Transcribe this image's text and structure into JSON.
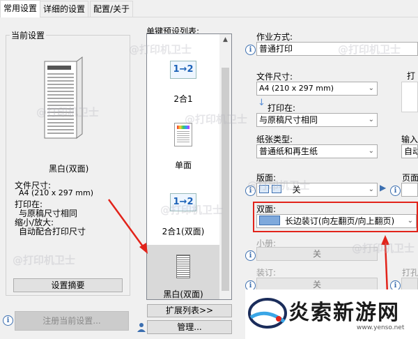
{
  "tabs": [
    "常用设置",
    "详细的设置",
    "配置/关于"
  ],
  "current": {
    "group_label": "当前设置",
    "preview_caption": "黑白(双面)",
    "paper_size_label": "文件尺寸:",
    "paper_size_value": "A4 (210 x 297 mm)",
    "print_on_label": "打印在:",
    "print_on_value": "与原稿尺寸相同",
    "scale_label": "缩小/放大:",
    "scale_value": "自动配合打印尺寸",
    "summary_button": "设置摘要",
    "register_button": "注册当前设置..."
  },
  "presets": {
    "label": "单键预设列表:",
    "items": [
      {
        "name": "2合1",
        "icon": "1→2"
      },
      {
        "name": "单面",
        "icon": ""
      },
      {
        "name": "2合1(双面)",
        "icon": "1→2"
      },
      {
        "name": "黑白(双面)",
        "icon": ""
      }
    ],
    "expand_button": "扩展列表>>",
    "manage_button": "管理..."
  },
  "settings": {
    "job_mode_label": "作业方式:",
    "job_mode_value": "普通打印",
    "page_size_label": "文件尺寸:",
    "page_size_value": "A4 (210 x 297 mm)",
    "print_on_label": "打印在:",
    "print_on_value": "与原稿尺寸相同",
    "paper_type_label": "纸张类型:",
    "paper_type_value": "普通纸和再生纸",
    "layout_label": "版面:",
    "layout_value": "关",
    "duplex_label": "双面:",
    "duplex_value": "长边装订(向左翻页/向上翻页)",
    "booklet_label": "小册:",
    "booklet_value": "关",
    "binding_label": "装订:",
    "binding_value": "关",
    "right_print_label": "打",
    "right_input_label": "输入",
    "right_input_value": "自动",
    "right_page_label": "页面",
    "right_punch_label": "打孔"
  },
  "watermarks": [
    "@打印机卫士"
  ],
  "logo_text": "炎索新游网",
  "logo_url": "www.yenso.net",
  "colors": {
    "accent_red": "#e2231a",
    "info_blue": "#3c6fb0"
  }
}
